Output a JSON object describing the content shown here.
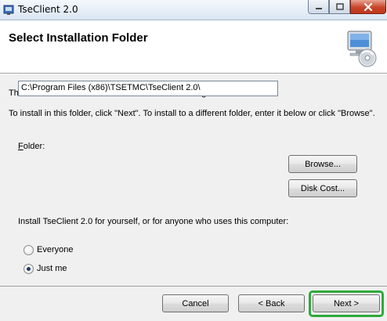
{
  "window": {
    "title": "TseClient 2.0",
    "close_glyph": "x"
  },
  "banner": {
    "title": "Select Installation Folder",
    "icon": "computer-cd-icon"
  },
  "body": {
    "line1": "The installer will install TseClient 2.0 to the following folder.",
    "line2": "To install in this folder, click \"Next\". To install to a different folder, enter it below or click \"Browse\".",
    "folder_label_first": "F",
    "folder_label_rest": "older:",
    "folder_path": "C:\\Program Files (x86)\\TSETMC\\TseClient 2.0\\",
    "browse_label": "Browse...",
    "disk_cost_label": "Disk Cost...",
    "install_for_label": "Install TseClient 2.0 for yourself, or for anyone who uses this computer:",
    "options": [
      {
        "label": "Everyone",
        "selected": false
      },
      {
        "label": "Just me",
        "selected": true
      }
    ]
  },
  "footer": {
    "cancel_label": "Cancel",
    "back_label": "< Back",
    "next_label": "Next >",
    "highlight_color": "#2faa3a"
  }
}
